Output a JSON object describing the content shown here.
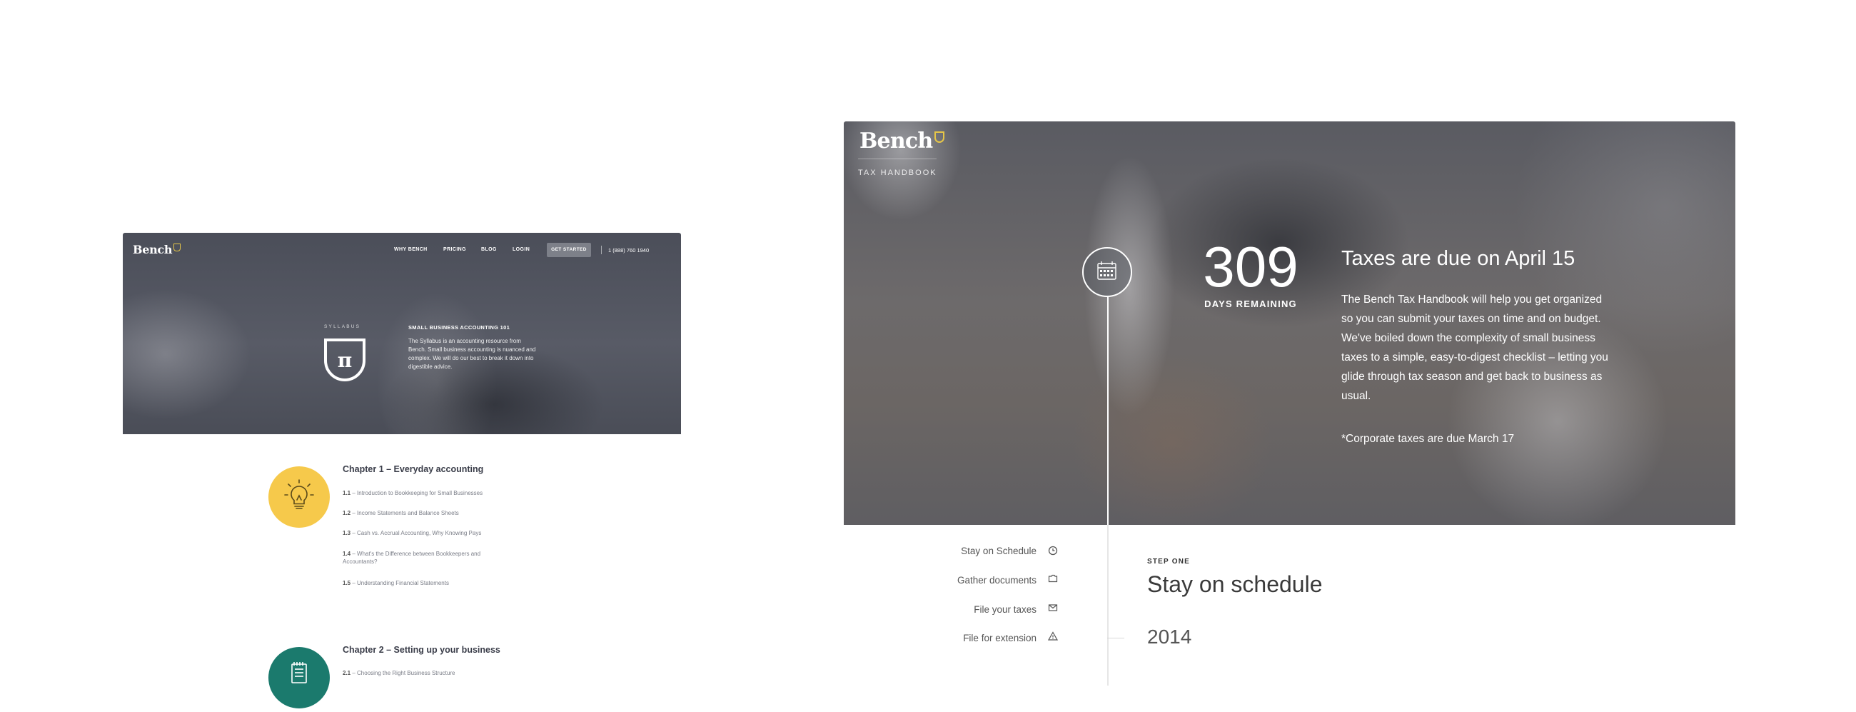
{
  "left": {
    "logo": "Bench",
    "nav": [
      "WHY BENCH",
      "PRICING",
      "BLOG",
      "LOGIN"
    ],
    "cta": "GET STARTED",
    "phone": "1 (888) 760 1940",
    "syllabus_label": "SYLLABUS",
    "course_title": "SMALL BUSINESS ACCOUNTING 101",
    "course_desc": "The Syllabus is an accounting resource from Bench. Small business accounting is nuanced and complex. We will do our best to break it down into digestible advice.",
    "chapters": [
      {
        "title": "Chapter 1 – Everyday accounting",
        "icon": "lightbulb-icon",
        "color": "#f6c94b",
        "items": [
          {
            "num": "1.1",
            "text": " – Introduction to Bookkeeping for Small Businesses"
          },
          {
            "num": "1.2",
            "text": " – Income Statements and Balance Sheets"
          },
          {
            "num": "1.3",
            "text": " – Cash vs. Accrual Accounting, Why Knowing Pays"
          },
          {
            "num": "1.4",
            "text": " – What's the Difference between Bookkeepers and Accountants?"
          },
          {
            "num": "1.5",
            "text": " – Understanding Financial Statements"
          }
        ]
      },
      {
        "title": "Chapter 2 – Setting up your business",
        "icon": "notepad-icon",
        "color": "#1b7a6d",
        "items": [
          {
            "num": "2.1",
            "text": " – Choosing the Right Business Structure"
          }
        ]
      }
    ]
  },
  "right": {
    "logo": "Bench",
    "subtitle": "TAX HANDBOOK",
    "days": "309",
    "days_label": "DAYS REMAINING",
    "heading": "Taxes are due on April 15",
    "body": "The Bench Tax Handbook will help you get organized so you can submit your taxes on time and on budget. We've boiled down the complexity of small business taxes to a simple, easy-to-digest checklist – letting you glide through tax season and get back to business as usual.",
    "note": "*Corporate taxes are due March 17",
    "steps": [
      {
        "label": "Stay on Schedule",
        "icon": "clock-icon"
      },
      {
        "label": "Gather documents",
        "icon": "folder-icon"
      },
      {
        "label": "File your taxes",
        "icon": "envelope-icon"
      },
      {
        "label": "File for extension",
        "icon": "warning-icon"
      }
    ],
    "step_kicker": "STEP ONE",
    "step_heading": "Stay on schedule",
    "year": "2014"
  }
}
